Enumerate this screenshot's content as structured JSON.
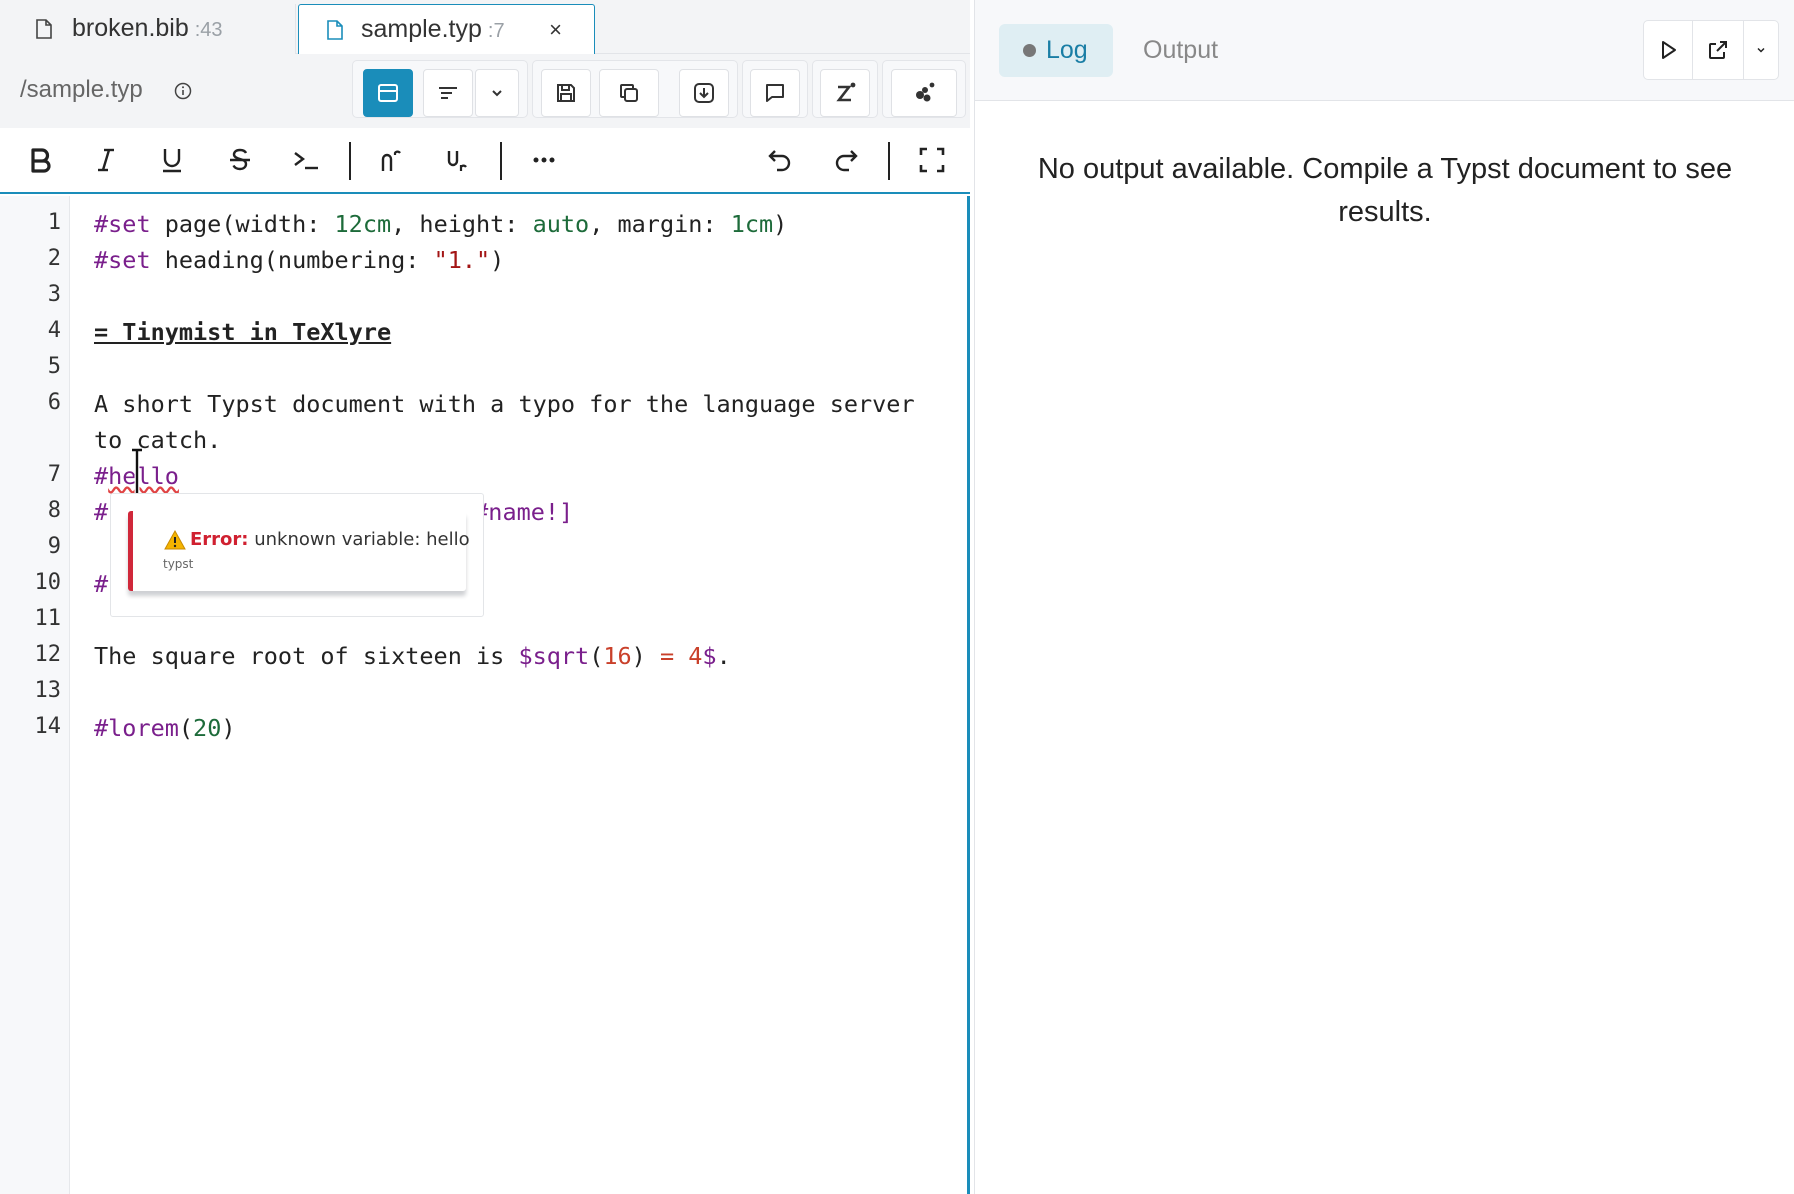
{
  "tabs": [
    {
      "name": "broken.bib",
      "count": ":43",
      "active": false
    },
    {
      "name": "sample.typ",
      "count": ":7",
      "active": true,
      "close": "×"
    }
  ],
  "path": "/sample.typ",
  "toolbar_icons": [
    "split-view-icon",
    "format-icon",
    "chevron-down-icon",
    "save-icon",
    "copy-icon",
    "download-icon",
    "comment-icon",
    "zotero-icon",
    "collab-icon"
  ],
  "format_icons": [
    "bold-icon",
    "italic-icon",
    "underline-icon",
    "strikethrough-icon",
    "code-icon",
    "superscript-icon",
    "subscript-icon",
    "more-icon",
    "undo-icon",
    "redo-icon",
    "fullscreen-icon"
  ],
  "line_numbers": [
    "1",
    "2",
    "3",
    "4",
    "5",
    "6",
    "7",
    "8",
    "9",
    "10",
    "11",
    "12",
    "13",
    "14"
  ],
  "code": {
    "l1": {
      "kw": "#set",
      "a": " page(width: ",
      "n1": "12cm",
      "b": ", height: ",
      "n2": "auto",
      "c": ", margin: ",
      "n3": "1cm",
      "d": ")"
    },
    "l2": {
      "kw": "#set",
      "a": " heading(numbering: ",
      "s": "\"1.\"",
      "b": ")"
    },
    "l4": "= Tinymist in TeXlyre",
    "l6a": "A short Typst document with a typo for the language server",
    "l6b": "to catch.",
    "l7": {
      "hash": "#",
      "word": "hello"
    },
    "l8": {
      "hash": "#",
      "tail": "#name!]"
    },
    "l10": {
      "hash": "#"
    },
    "l12": {
      "a": "The square root of sixteen is ",
      "dollar": "$",
      "fn": "sqrt",
      "p1": "(",
      "n": "16",
      "p2": ")",
      "eq": " = ",
      "n2": "4",
      "end": "$",
      "dot": "."
    },
    "l14": {
      "kw": "#lorem",
      "p1": "(",
      "n": "20",
      "p2": ")"
    }
  },
  "tooltip": {
    "label": "Error:",
    "message": " unknown variable: hello",
    "source": "typst"
  },
  "output": {
    "tabs": [
      "Log",
      "Output"
    ],
    "active_tab": "Log",
    "empty_message": "No output available. Compile a Typst document to see results."
  },
  "colors": {
    "accent": "#1a8dba",
    "error": "#d0283a",
    "keyword": "#7a1f8c",
    "number": "#1d6b3a",
    "string": "#a31515"
  }
}
